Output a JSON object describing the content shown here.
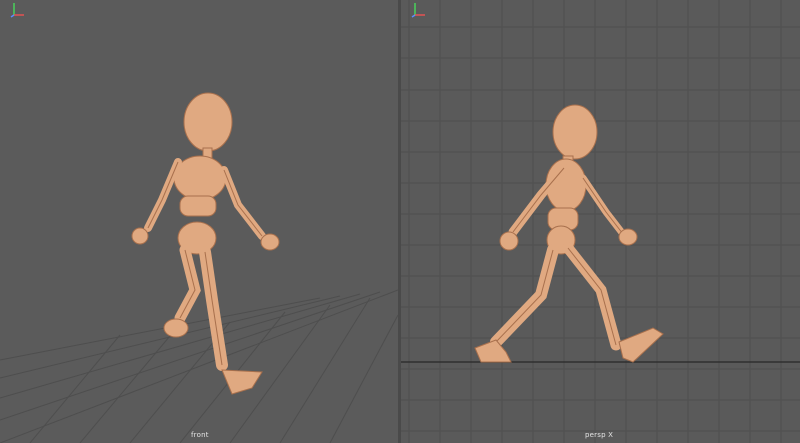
{
  "viewports": [
    {
      "camera_label": "front",
      "grid": true
    },
    {
      "camera_label": "persp X",
      "grid": true
    }
  ],
  "colors": {
    "viewport_bg": "#5b5b5b",
    "grid_line": "#4d4d4d",
    "character_skin": "#e0a981",
    "character_shadow": "#a8704d"
  },
  "icons": [
    "axis-gizmo-icon"
  ]
}
